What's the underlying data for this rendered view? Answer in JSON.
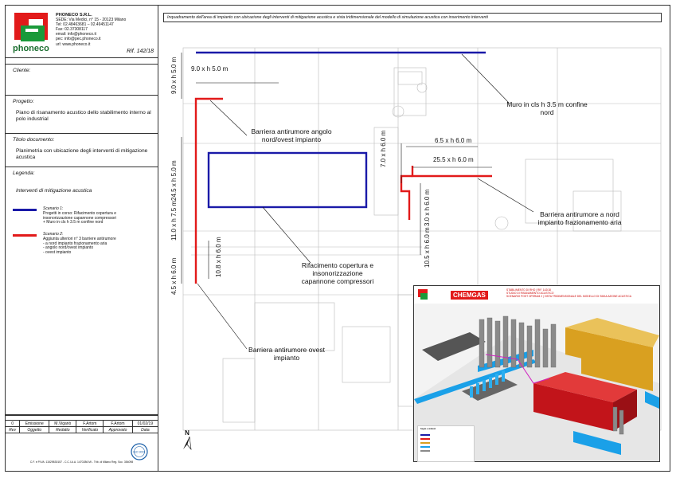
{
  "company": {
    "logo_text": "phoneco",
    "name": "PHONECO S.R.L.",
    "address": "SEDE: Via Medici, n° 15 - 20123 Milano",
    "tel": "Tel: 02.48463681 – 02.49451147",
    "fax": "Fax: 02.37308117",
    "email": "email: info@phoneco.it",
    "pec": "pec: info@pec.phoneco.it",
    "url": "url: www.phoneco.it"
  },
  "ref": "Rif. 142/18",
  "sections": {
    "cliente_label": "Cliente:",
    "progetto_label": "Progetto:",
    "progetto_text": "Piano di risanamento acustico dello stabilimento interno al polo industrial",
    "titolo_label": "Titolo documento:",
    "titolo_text": "Planimetria con ubicazione degli interventi di mitigazione acustica",
    "legenda_label": "Legenda:",
    "legenda_heading": "Interventi di mitigazione acustica"
  },
  "legend": [
    {
      "color": "#1a1aa8",
      "scenario": "Scenario 1:",
      "lines": [
        "Progetti in corso: Rifacimento copertura e",
        "insonorizzazione capannone compressori",
        "+ Muro in cls h 3.5 m confine nord"
      ]
    },
    {
      "color": "#e21a1a",
      "scenario": "Scenario 2:",
      "lines": [
        "Aggiunta ulteriori n° 3 barriere antirumore",
        "- a nord impianto frazionamento aria",
        "- angolo nord/ovest impianto",
        "- ovest impianto"
      ]
    }
  ],
  "revision_table": {
    "row": [
      "0",
      "Emissione",
      "M.Viganò",
      "F.Artom",
      "F.Artom",
      "01/02/19"
    ],
    "header": [
      "Rev",
      "Oggetto",
      "Redatto",
      "Verificato",
      "Approvato",
      "Data"
    ]
  },
  "footer": "C.F. e P.IVA: 11529830157 - C.C.I.A.A. 1470286 MI - Trib. di Milano Reg. Soc. 354098",
  "seal_text": "ISO 9001",
  "title_banner": "Inquadramento dell'area di impianto con ubicazione degli interventi di mitigazione acustica e vista tridimensionale del modello di simulazione acustica con inserimento interventi",
  "annotations": {
    "muro": "Muro in cls h 3.5 m confine nord",
    "barriera_angolo": "Barriera antirumore angolo nord/ovest impianto",
    "barriera_nord": "Barriera antirumore a nord impianto frazionamento aria",
    "rifacimento": "Rifacimento copertura e insonorizzazione capannone compressori",
    "barriera_ovest": "Barriera antirumore ovest impianto"
  },
  "dimensions": {
    "d1": "9.0 x h 5.0 m",
    "d2": "9.0 x h 5.0 m",
    "d3": "24.5 x h 5.0 m",
    "d4": "11.0 x h 7.5 m",
    "d5": "10.8 x h 6.0 m",
    "d6": "4.5 x h 6.0 m",
    "d7": "7.0 x h 6.0 m",
    "d8": "6.5 x h 6.0 m",
    "d9": "25.5 x h 6.0 m",
    "d10": "3.0 x h 6.0 m",
    "d11": "10.5 x h 6.0 m"
  },
  "inset": {
    "chemgas": "CHEMGAS",
    "lines": [
      "STABILIMENTO DI RHO | RIF. 142/18",
      "STUDIO DI RISANAMENTO ACUSTICO",
      "SCENARIO POST OPERAM 2 | VISTA TRIDIMENSIONALE DEL MODELLO DI SIMULAZIONE ACUSTICA"
    ],
    "legend_title": "Segni e simboli"
  },
  "colors": {
    "blue": "#1a1aa8",
    "red": "#e21a1a"
  }
}
